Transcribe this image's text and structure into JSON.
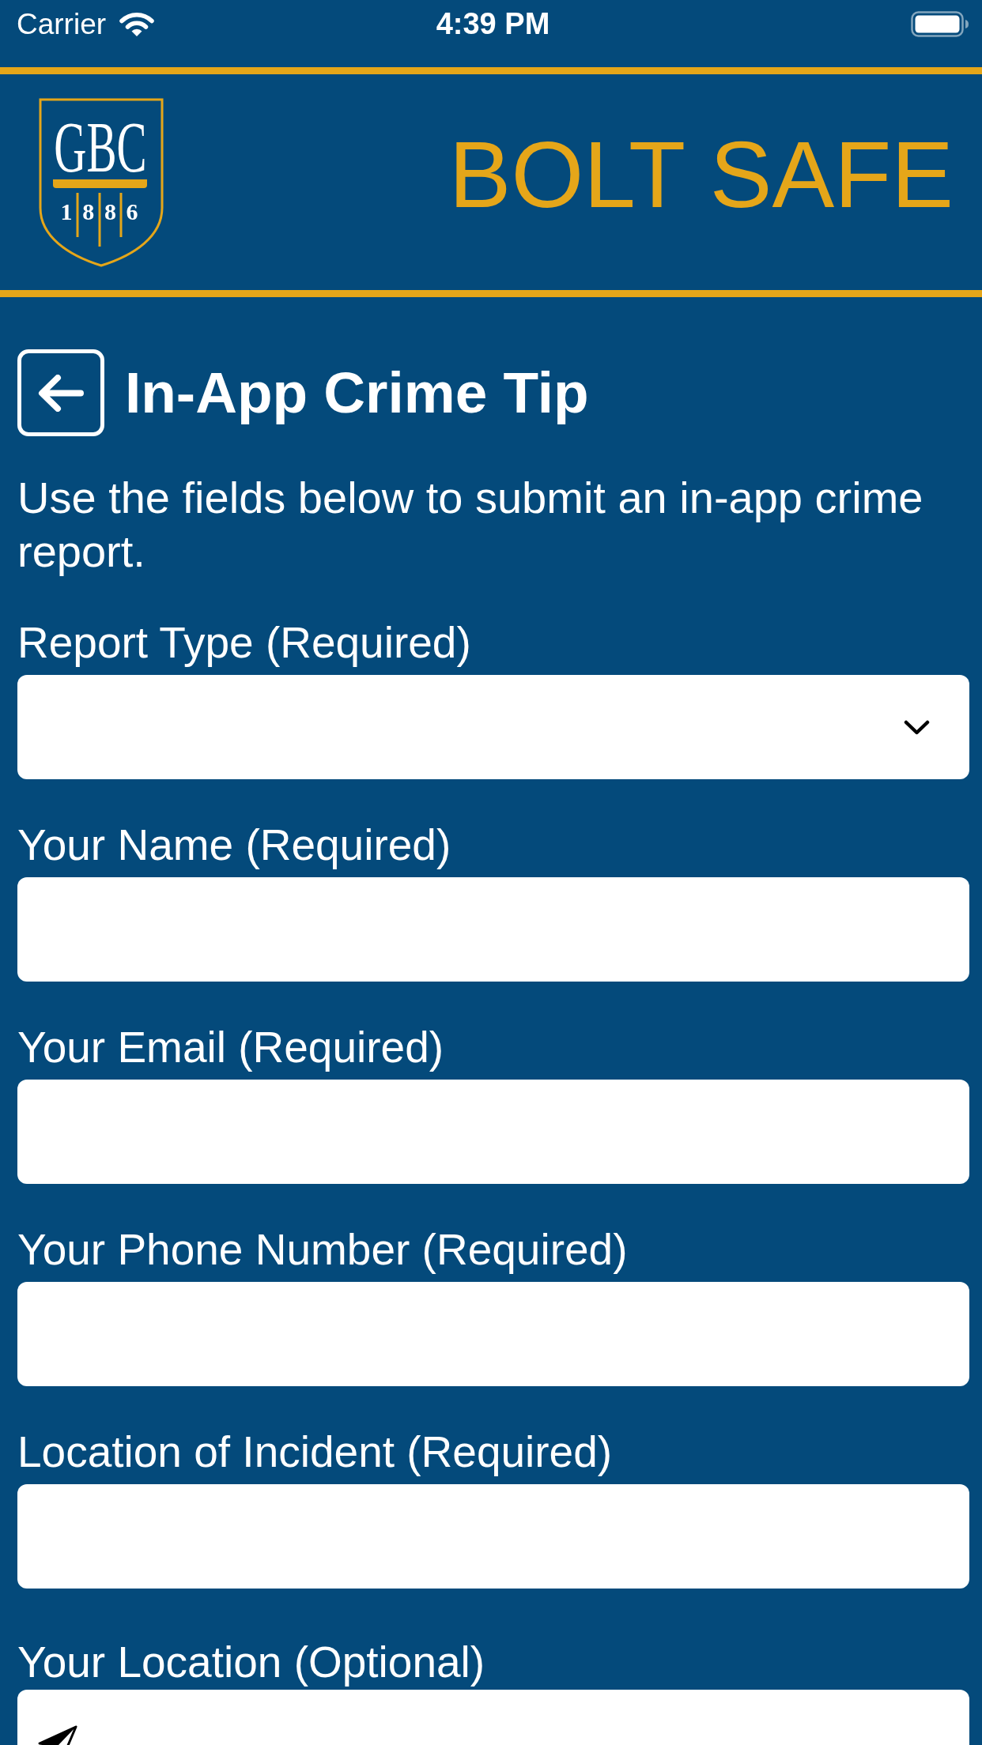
{
  "status_bar": {
    "carrier": "Carrier",
    "time": "4:39 PM"
  },
  "header": {
    "logo": {
      "monogram": "GBC",
      "year_digits": [
        "1",
        "8",
        "8",
        "6"
      ]
    },
    "title": "BOLT SAFE"
  },
  "page": {
    "title": "In-App Crime Tip",
    "description": "Use the fields below to submit an in-app crime report."
  },
  "fields": [
    {
      "label": "Report Type (Required)",
      "kind": "select"
    },
    {
      "label": "Your Name (Required)",
      "kind": "text"
    },
    {
      "label": "Your Email (Required)",
      "kind": "text"
    },
    {
      "label": "Your Phone Number (Required)",
      "kind": "text"
    },
    {
      "label": "Location of Incident (Required)",
      "kind": "text"
    },
    {
      "label": "Your Location (Optional)",
      "kind": "location"
    }
  ]
}
